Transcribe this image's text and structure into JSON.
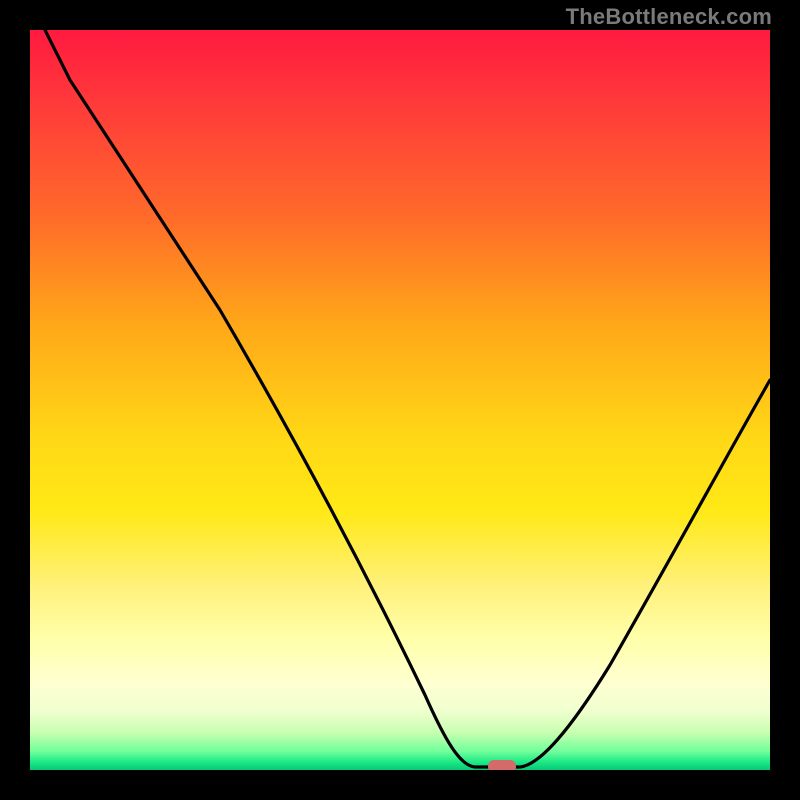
{
  "watermark": "TheBottleneck.com",
  "colors": {
    "frame": "#000000",
    "gradient_top": "#ff1a40",
    "gradient_mid": "#ffe916",
    "gradient_bottom": "#08c878",
    "marker": "#d46a6a",
    "curve": "#000000"
  },
  "chart_data": {
    "type": "line",
    "title": "",
    "xlabel": "",
    "ylabel": "",
    "xlim": [
      0,
      100
    ],
    "ylim": [
      0,
      100
    ],
    "x": [
      0,
      5,
      10,
      15,
      20,
      25,
      30,
      35,
      40,
      45,
      50,
      55,
      58,
      60,
      62,
      64,
      66,
      70,
      75,
      80,
      85,
      90,
      95,
      100
    ],
    "values": [
      100,
      91,
      82,
      73,
      64,
      55,
      47,
      40,
      33,
      26,
      19,
      12,
      6,
      2,
      0,
      0,
      0,
      4,
      12,
      22,
      32,
      42,
      52,
      62
    ],
    "marker": {
      "x": 64,
      "y": 0
    },
    "annotations": []
  }
}
